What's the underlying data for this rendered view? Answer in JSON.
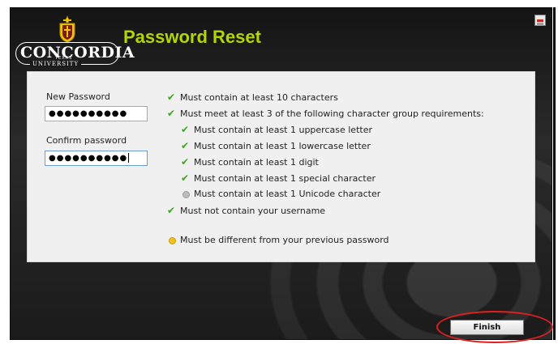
{
  "header": {
    "title": "Password Reset",
    "logo_text": "CONCORDIA",
    "logo_sub": "UNIVERSITY",
    "logo_state": "TEXAS"
  },
  "form": {
    "new_password_label": "New Password",
    "new_password_value": "●●●●●●●●●●",
    "confirm_password_label": "Confirm password",
    "confirm_password_value": "●●●●●●●●●●"
  },
  "requirements": [
    {
      "text": "Must contain at least 10 characters",
      "status": "met",
      "indent": 0
    },
    {
      "text": "Must meet at least 3 of the following character group requirements:",
      "status": "met",
      "indent": 0
    },
    {
      "text": "Must contain at least 1 uppercase letter",
      "status": "met",
      "indent": 1
    },
    {
      "text": "Must contain at least 1 lowercase letter",
      "status": "met",
      "indent": 1
    },
    {
      "text": "Must contain at least 1 digit",
      "status": "met",
      "indent": 1
    },
    {
      "text": "Must contain at least 1 special character",
      "status": "met",
      "indent": 1
    },
    {
      "text": "Must contain at least 1 Unicode character",
      "status": "unmet",
      "indent": 1
    },
    {
      "text": "Must not contain your username",
      "status": "met",
      "indent": 0
    },
    {
      "text": "Must be different from your previous password",
      "status": "pending",
      "indent": 0
    }
  ],
  "buttons": {
    "finish_label": "Finish"
  },
  "colors": {
    "title": "#b4d500",
    "check": "#3aa71b",
    "pending": "#f2c21b",
    "highlight": "#e11f1f"
  }
}
